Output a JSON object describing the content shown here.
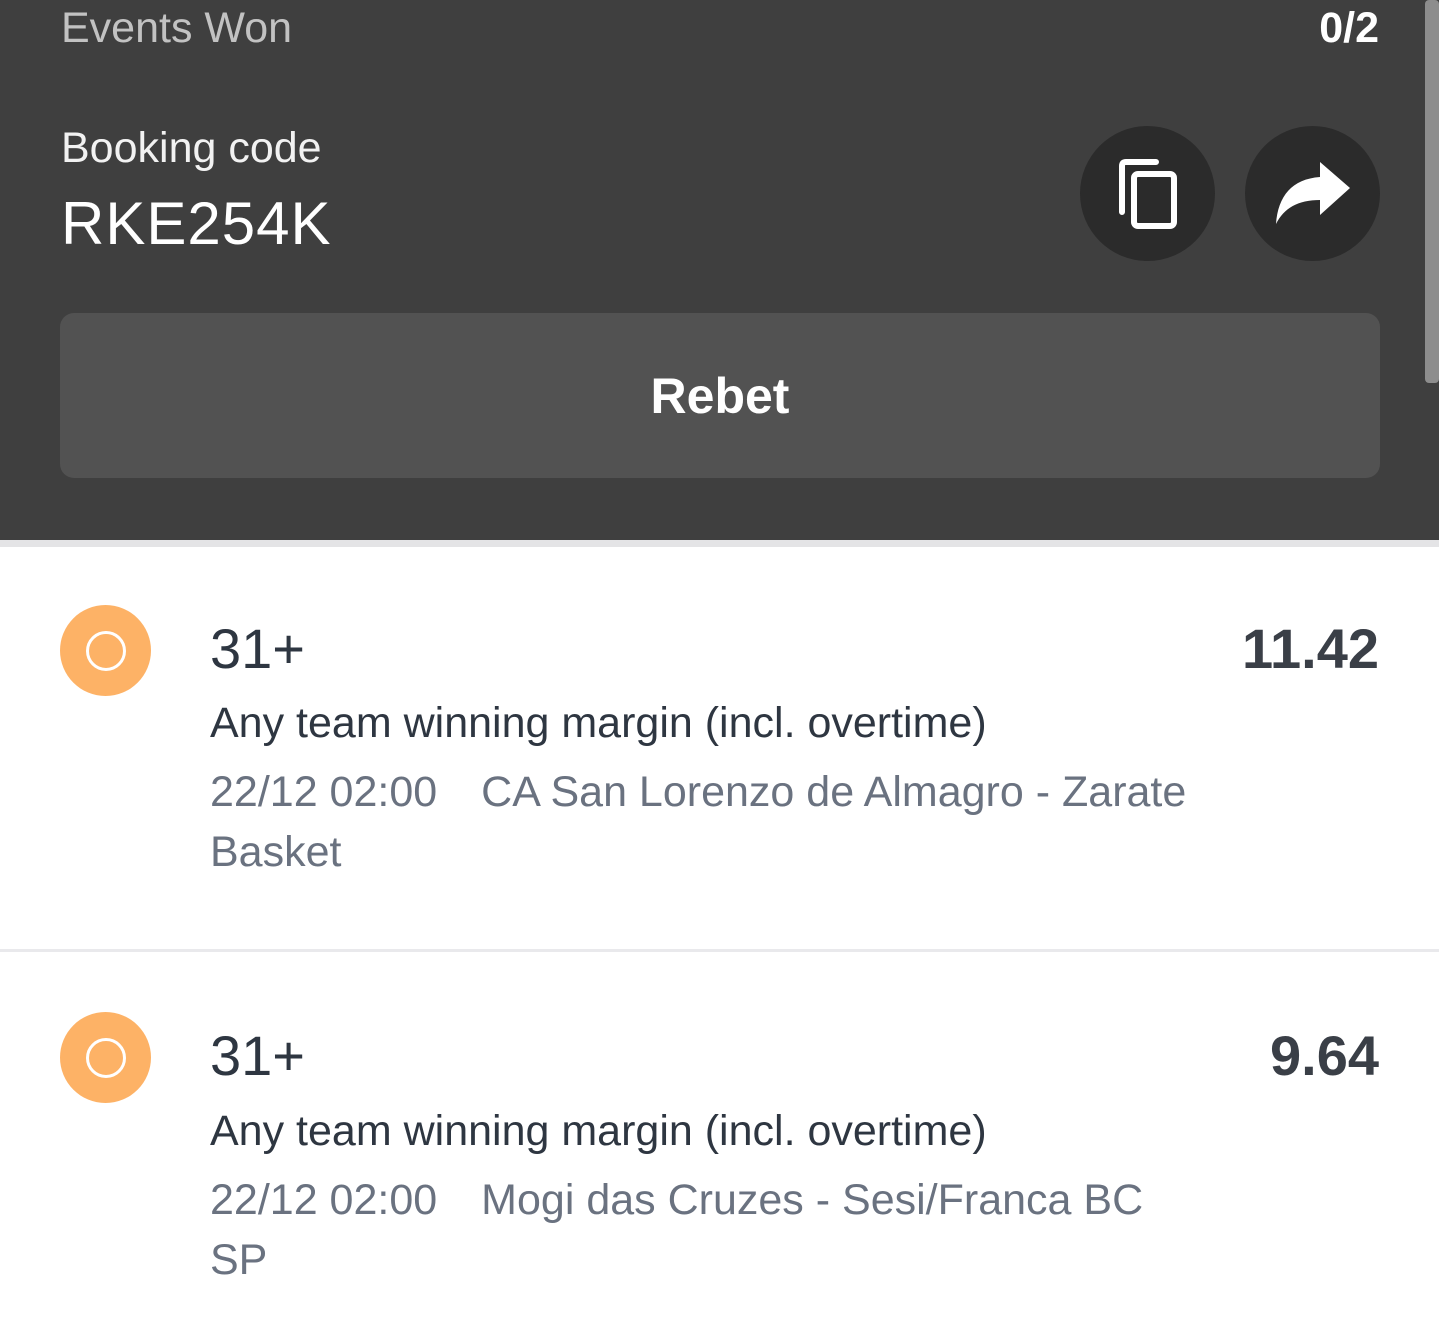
{
  "summary": {
    "events_won_label": "Events Won",
    "events_won_value": "0/2",
    "booking_code_label": "Booking code",
    "booking_code": "RKE254K",
    "copy_icon": "copy-icon",
    "share_icon": "share-icon",
    "rebet_label": "Rebet"
  },
  "colors": {
    "header_bg": "#3f3f3f",
    "rebet_bg": "#525252",
    "pending_status": "#fdb266"
  },
  "events": [
    {
      "status": "pending",
      "pick": "31+",
      "odds": "11.42",
      "market": "Any team winning margin (incl. overtime)",
      "time": "22/12 02:00",
      "match": "CA San Lorenzo de Almagro - Zarate Basket"
    },
    {
      "status": "pending",
      "pick": "31+",
      "odds": "9.64",
      "market": "Any team winning margin (incl. overtime)",
      "time": "22/12 02:00",
      "match": "Mogi das Cruzes - Sesi/Franca BC SP"
    }
  ]
}
